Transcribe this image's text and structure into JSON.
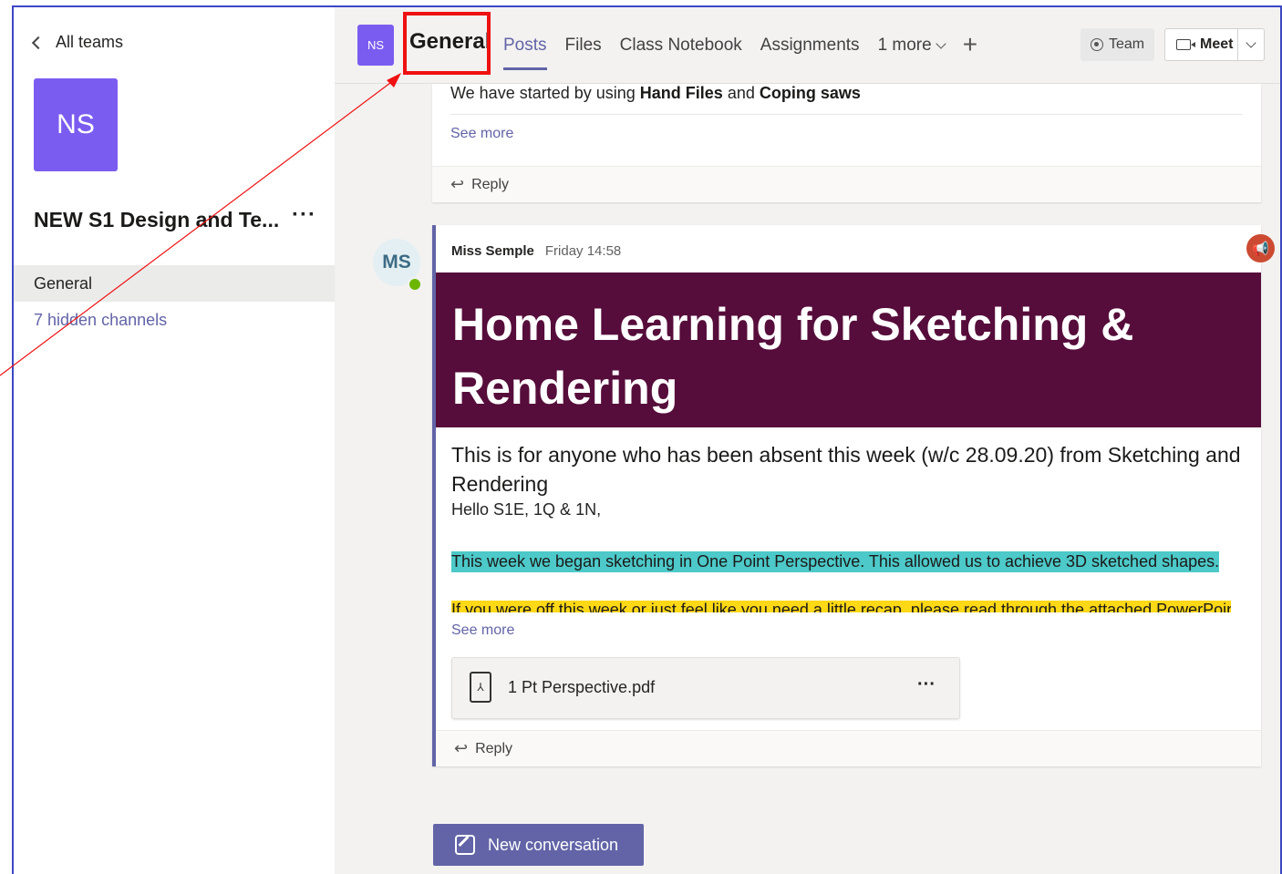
{
  "sidebar": {
    "back_label": "All teams",
    "team_initials": "NS",
    "team_name": "NEW S1 Design and Te...",
    "more_label": "···",
    "channels": [
      {
        "label": "General"
      }
    ],
    "hidden_channels_label": "7 hidden channels"
  },
  "header": {
    "team_initials": "NS",
    "channel_title": "General",
    "tabs": [
      {
        "label": "Posts",
        "active": true
      },
      {
        "label": "Files"
      },
      {
        "label": "Class Notebook"
      },
      {
        "label": "Assignments"
      },
      {
        "label": "1 more"
      }
    ],
    "team_button": "Team",
    "meet_button": "Meet"
  },
  "feed": {
    "post1": {
      "text_prefix": "We have started by using ",
      "bold1": "Hand Files",
      "text_mid": " and ",
      "bold2": "Coping saws",
      "see_more": "See more",
      "reply": "Reply"
    },
    "post2": {
      "author_initials": "MS",
      "author": "Miss Semple",
      "time": "Friday 14:58",
      "banner_title": "Home Learning for Sketching & Rendering",
      "subhead": "This is for anyone who has been absent this week (w/c 28.09.20) from Sketching and Rendering",
      "greeting": "Hello S1E, 1Q & 1N,",
      "highlight_cyan": "This week we began sketching in One Point Perspective. This allowed us to achieve 3D sketched shapes.",
      "highlight_yellow": "If you were off this week or just feel like you need a little recap, please read through the attached PowerPoint",
      "see_more": "See more",
      "attachment_name": "1 Pt Perspective.pdf",
      "attachment_more": "···",
      "reply": "Reply"
    },
    "new_conversation": "New conversation"
  },
  "colors": {
    "accent": "#6264a7",
    "team_avatar": "#7b5cf0",
    "banner": "#560d3b",
    "highlight_cyan": "#4dc9c9",
    "highlight_yellow": "#ffd816",
    "annotation_red": "#e11111"
  },
  "icons": [
    "chevron-left-icon",
    "chevron-down-icon",
    "plus-icon",
    "eye-icon",
    "video-camera-icon",
    "reply-arrow-icon",
    "announcement-icon",
    "pdf-file-icon",
    "compose-icon",
    "presence-available-icon"
  ]
}
